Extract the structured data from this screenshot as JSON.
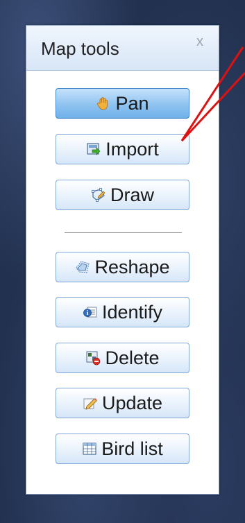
{
  "panel": {
    "title": "Map tools",
    "close_glyph": "x"
  },
  "tools": [
    {
      "label": "Pan",
      "icon": "hand-icon",
      "active": true
    },
    {
      "label": "Import",
      "icon": "import-icon",
      "active": false
    },
    {
      "label": "Draw",
      "icon": "draw-polygon-icon",
      "active": false
    },
    {
      "label": "Reshape",
      "icon": "reshape-icon",
      "active": false
    },
    {
      "label": "Identify",
      "icon": "identify-icon",
      "active": false
    },
    {
      "label": "Delete",
      "icon": "delete-icon",
      "active": false
    },
    {
      "label": "Update",
      "icon": "update-pencil-icon",
      "active": false
    },
    {
      "label": "Bird list",
      "icon": "table-grid-icon",
      "active": false
    }
  ],
  "colors": {
    "annotation_arrow": "#e01010",
    "active_button": "#8fc3f0",
    "map_background": "#22314f"
  }
}
